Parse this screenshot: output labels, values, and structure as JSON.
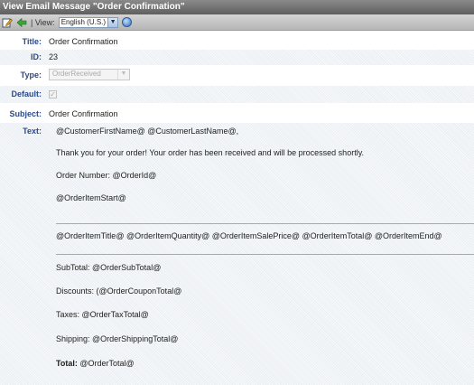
{
  "window": {
    "title": "View Email Message \"Order Confirmation\""
  },
  "toolbar": {
    "view_label": "| View:",
    "language": "English (U.S.)",
    "icons": [
      "edit-icon",
      "back-arrow-icon",
      "globe-icon"
    ]
  },
  "fields": {
    "title_label": "Title:",
    "title_value": "Order Confirmation",
    "id_label": "ID:",
    "id_value": "23",
    "type_label": "Type:",
    "type_value": "OrderReceived",
    "default_label": "Default:",
    "default_checked": "✓",
    "subject_label": "Subject:",
    "subject_value": "Order Confirmation",
    "text_label": "Text:"
  },
  "body_text": {
    "greeting": "@CustomerFirstName@ @CustomerLastName@,",
    "thanks": "Thank you for your order! Your order has been received and will be processed shortly.",
    "order_number": "Order Number: @OrderId@",
    "item_start": "@OrderItemStart@",
    "item_line": "@OrderItemTitle@ @OrderItemQuantity@ @OrderItemSalePrice@ @OrderItemTotal@ @OrderItemEnd@",
    "subtotal": "SubTotal: @OrderSubTotal@",
    "discounts": "Discounts: (@OrderCouponTotal@",
    "taxes": "Taxes: @OrderTaxTotal@",
    "shipping": "Shipping: @OrderShippingTotal@",
    "total_label": "Total:",
    "total_value": " @OrderTotal@"
  }
}
